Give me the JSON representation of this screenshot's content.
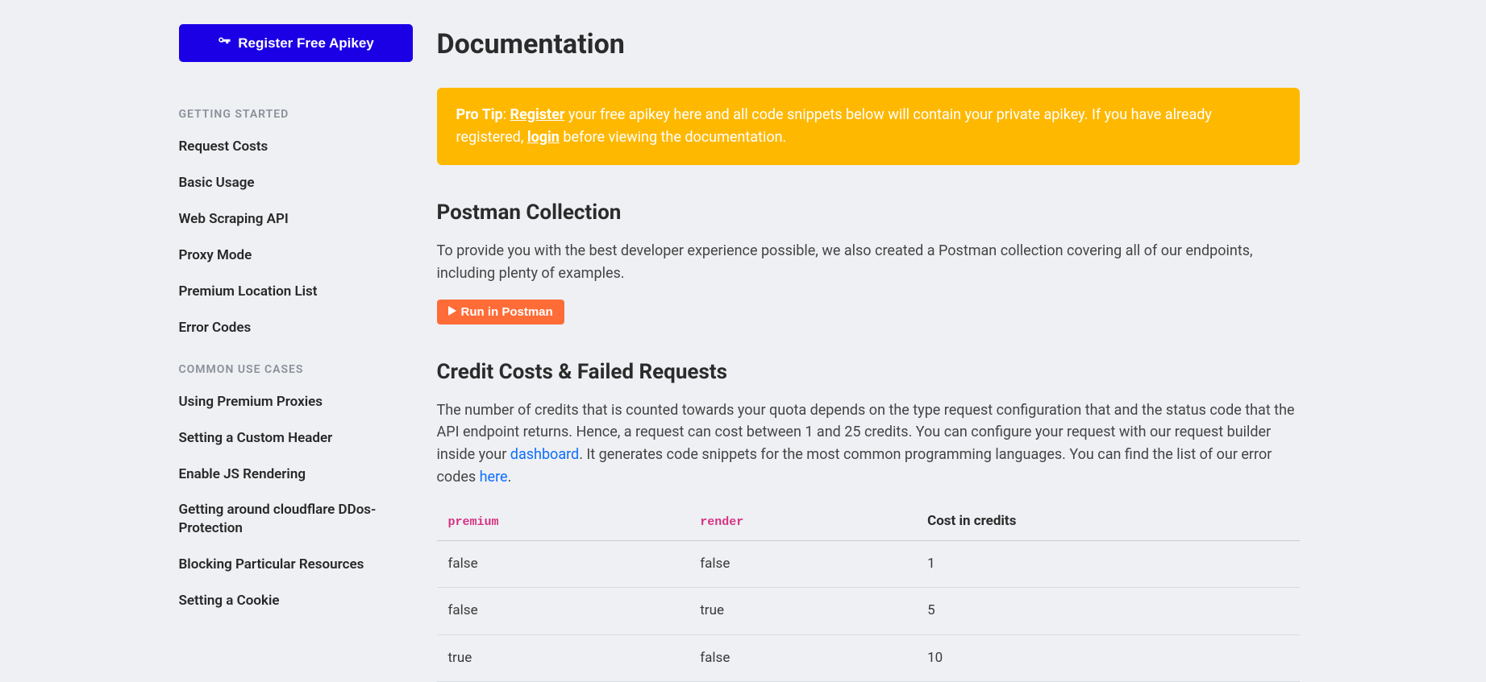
{
  "sidebar": {
    "register_label": "Register Free Apikey",
    "sections": [
      {
        "heading": "Getting Started",
        "items": [
          "Request Costs",
          "Basic Usage",
          "Web Scraping API",
          "Proxy Mode",
          "Premium Location List",
          "Error Codes"
        ]
      },
      {
        "heading": "Common Use Cases",
        "items": [
          "Using Premium Proxies",
          "Setting a Custom Header",
          "Enable JS Rendering",
          "Getting around cloudflare DDos-Protection",
          "Blocking Particular Resources",
          "Setting a Cookie"
        ]
      }
    ]
  },
  "main": {
    "title": "Documentation",
    "tip": {
      "lead": "Pro Tip",
      "sep": ": ",
      "register_link": "Register",
      "text_1": " your free apikey here and all code snippets below will contain your private apikey. If you have already registered, ",
      "login_link": "login",
      "text_2": " before viewing the documentation."
    },
    "postman": {
      "heading": "Postman Collection",
      "body": "To provide you with the best developer experience possible, we also created a Postman collection covering all of our endpoints, including plenty of examples.",
      "button": "Run in Postman"
    },
    "credits": {
      "heading": "Credit Costs & Failed Requests",
      "body_1": "The number of credits that is counted towards your quota depends on the type request configuration that and the status code that the API endpoint returns. Hence, a request can cost between 1 and 25 credits. You can configure your request with our request builder inside your ",
      "dashboard_link": "dashboard",
      "body_2": ". It generates code snippets for the most common programming languages. You can find the list of our error codes ",
      "here_link": "here",
      "body_3": ".",
      "table": {
        "headers": [
          "premium",
          "render",
          "Cost in credits"
        ],
        "rows": [
          [
            "false",
            "false",
            "1"
          ],
          [
            "false",
            "true",
            "5"
          ],
          [
            "true",
            "false",
            "10"
          ]
        ]
      }
    }
  }
}
